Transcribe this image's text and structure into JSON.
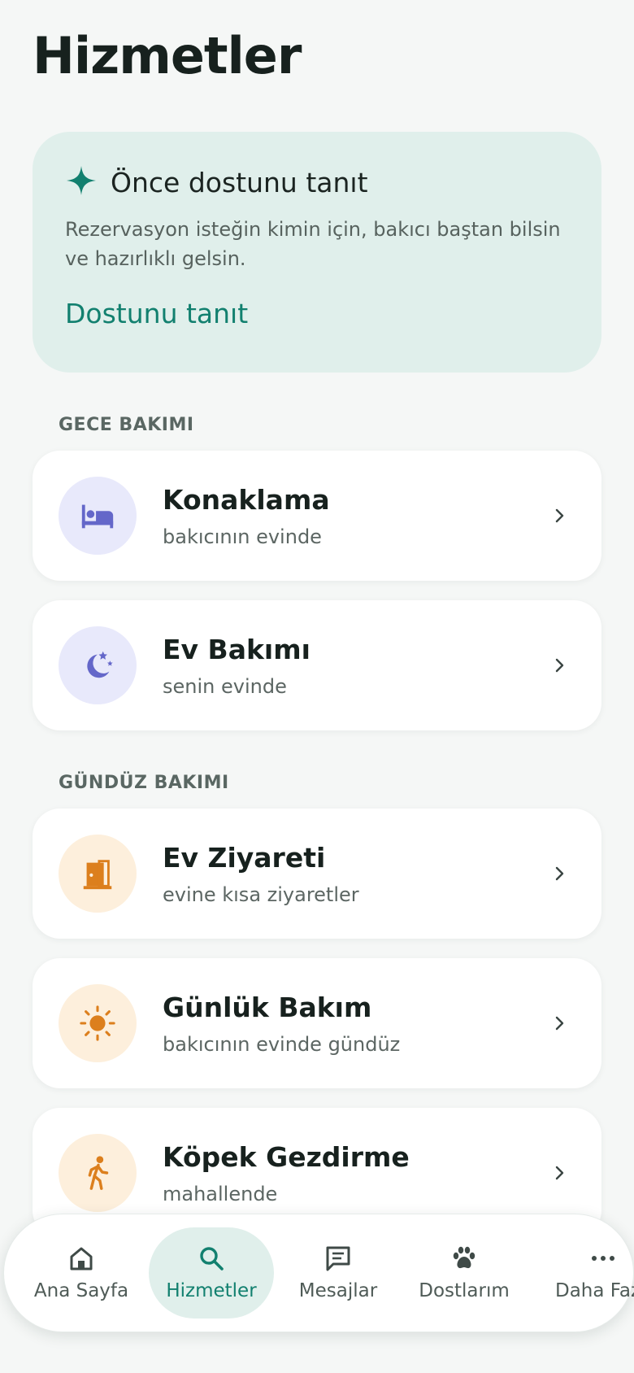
{
  "header": {
    "title": "Hizmetler"
  },
  "promo": {
    "title": "Önce dostunu tanıt",
    "text": "Rezervasyon isteğin kimin için, bakıcı baştan bilsin ve hazırlıklı gelsin.",
    "link": "Dostunu tanıt",
    "accent": "#12806f",
    "background": "#e0efeb"
  },
  "sections": [
    {
      "label": "GECE BAKIMI",
      "items": [
        {
          "title": "Konaklama",
          "subtitle": "bakıcının evinde",
          "icon": "bed-icon"
        },
        {
          "title": "Ev Bakımı",
          "subtitle": "senin evinde",
          "icon": "moon-stars-icon"
        }
      ]
    },
    {
      "label": "GÜNDÜZ BAKIMI",
      "items": [
        {
          "title": "Ev Ziyareti",
          "subtitle": "evine kısa ziyaretler",
          "icon": "door-icon"
        },
        {
          "title": "Günlük Bakım",
          "subtitle": "bakıcının evinde gündüz",
          "icon": "sun-icon"
        },
        {
          "title": "Köpek Gezdirme",
          "subtitle": "mahallende",
          "icon": "walking-icon"
        }
      ]
    }
  ],
  "colors": {
    "night_icon": "#6467c9",
    "night_bg": "#e8e9fb",
    "day_icon": "#dc7f1d",
    "day_bg": "#fdefdc"
  },
  "nav": {
    "items": [
      {
        "label": "Ana Sayfa",
        "icon": "home-icon"
      },
      {
        "label": "Hizmetler",
        "icon": "search-icon",
        "active": true
      },
      {
        "label": "Mesajlar",
        "icon": "message-icon"
      },
      {
        "label": "Dostlarım",
        "icon": "paw-icon"
      },
      {
        "label": "Daha Fazla",
        "icon": "more-icon"
      }
    ]
  }
}
